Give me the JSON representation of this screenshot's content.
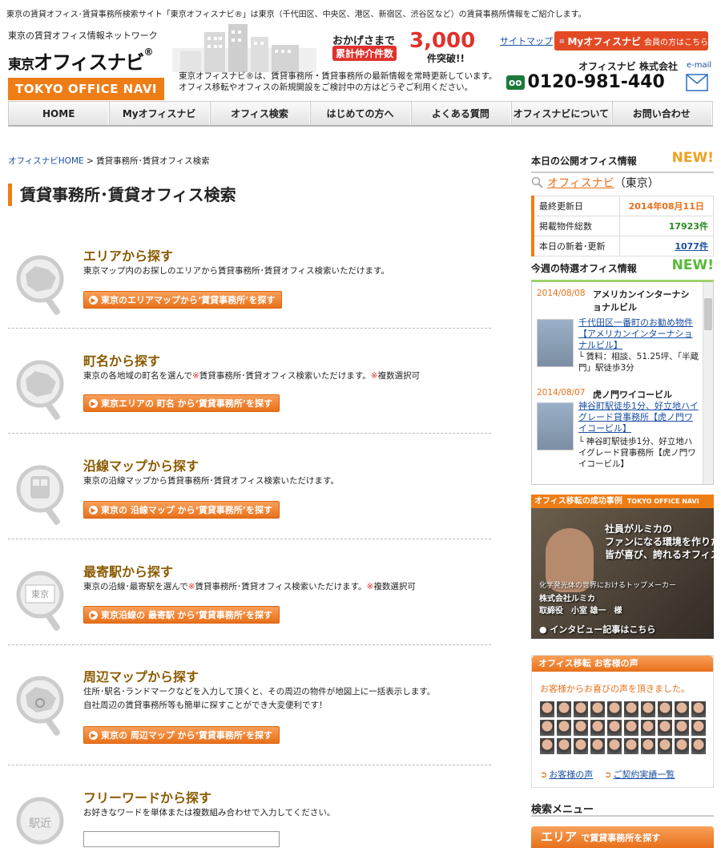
{
  "header": {
    "tagline": "東京の賃貸オフィス･賃貸事務所検索サイト「東京オフィスナビ®」は東京（千代田区、中央区、港区、新宿区、渋谷区など）の賃貸事務所情報をご紹介します。",
    "logo_sub": "東京の賃貸オフィス情報ネットワーク",
    "logo_small": "東京",
    "logo_main": "オフィスナビ",
    "logo_reg": "®",
    "logo_en": "TOKYO OFFICE NAVI",
    "desc_line1": "東京オフィスナビ®は、賃貸事務所・賃貸事務所の最新情報を常時更新しています。",
    "desc_line2": "オフィス移転やオフィスの新規開設をご検討中の方はどうぞご利用ください。",
    "okage_line1": "おかげさまで",
    "okage_line2": "累計仲介件数",
    "okage_num": "3,000",
    "okage_line3": "件突破!!",
    "sitemap": "サイトマップ",
    "my_btn": "Myオフィスナビ",
    "my_btn_small": "会員の方はこちら",
    "company": "オフィスナビ 株式会社",
    "email_label": "e-mail",
    "phone_prefix": "0120",
    "phone": "0120-981-440",
    "phone_badge": "フリーダイヤル"
  },
  "nav": [
    "HOME",
    "Myオフィスナビ",
    "オフィス検索",
    "はじめての方へ",
    "よくある質問",
    "オフィスナビについて",
    "お問い合わせ"
  ],
  "breadcrumb": {
    "home": "オフィスナビHOME",
    "sep": " > ",
    "current": "賃貸事務所･賃貸オフィス検索"
  },
  "page_title": "賃貸事務所･賃貸オフィス検索",
  "sections": [
    {
      "title": "エリアから探す",
      "desc": "東京マップ内のお探しのエリアから賃貸事務所･賃貸オフィス検索いただけます。",
      "button": "東京のエリアマップから‘賃貸事務所’を探す"
    },
    {
      "title": "町名から探す",
      "desc_a": "東京の各地域の町名を選んで",
      "desc_ast1": "※",
      "desc_b": "賃貸事務所･賃貸オフィス検索いただけます。",
      "desc_ast2": "※",
      "desc_c": "複数選択可",
      "button": "東京エリアの 町名 から‘賃貸事務所’を探す"
    },
    {
      "title": "沿線マップから探す",
      "desc": "東京の沿線マップから賃貸事務所･賃貸オフィス検索いただけます。",
      "button": "東京の 沿線マップ から‘賃貸事務所’を探す"
    },
    {
      "title": "最寄駅から探す",
      "desc_a": "東京の沿線･最寄駅を選んで",
      "desc_ast1": "※",
      "desc_b": "賃貸事務所･賃貸オフィス検索いただけます。",
      "desc_ast2": "※",
      "desc_c": "複数選択可",
      "button": "東京沿線の 最寄駅 から‘賃貸事務所’を探す",
      "icon_text": "東京"
    },
    {
      "title": "周辺マップから探す",
      "desc_line1": "住所･駅名･ランドマークなどを入力して頂くと、その周辺の物件が地図上に一括表示します。",
      "desc_line2": "自社周辺の賃貸事務所等も簡単に探すことができ大変便利です！",
      "button": "東京の 周辺マップ から‘賃貸事務所’を探す"
    },
    {
      "title": "フリーワードから探す",
      "desc": "お好きなワードを単体または複数組み合わせで入力してください。",
      "icon_text": "駅近"
    }
  ],
  "sidebar": {
    "today_title": "本日の公開オフィス情報",
    "new_badge": "NEW!",
    "search_link": "オフィスナビ",
    "search_suffix": "（東京）",
    "rows": [
      {
        "label": "最終更新日",
        "value": "2014年08月11日"
      },
      {
        "label": "掲載物件総数",
        "value": "17923件"
      },
      {
        "label": "本日の新着･更新",
        "value": "1077件"
      }
    ],
    "featured_title": "今週の特選オフィス情報",
    "featured": [
      {
        "date": "2014/08/08",
        "name": "アメリカンインターナショナルビル",
        "link": "千代田区一番町のお勧め物件【アメリカンインターナショナルビル】",
        "desc": "└ 賃料：相談、51.25坪、「半蔵門」駅徒歩3分"
      },
      {
        "date": "2014/08/07",
        "name": "虎ノ門ワイコービル",
        "link": "神谷町駅徒歩1分、好立地ハイグレード貸事務所【虎ノ門ワイコービル】",
        "desc": "└ 神谷町駅徒歩1分、好立地ハイグレード貸事務所【虎ノ門ワイコービル】"
      }
    ],
    "success_bar": "オフィス移転の成功事例",
    "success_bar_en": "TOKYO OFFICE NAVI",
    "success_quote1": "社員がルミカの",
    "success_quote2": "ファンになる環境を作りたい。",
    "success_quote3": "皆が喜び、誇れるオフィスに。",
    "success_company1": "化学発光体の世界におけるトップメーカー",
    "success_company2": "株式会社ルミカ",
    "success_person": "取締役　小室 雄一　様",
    "success_link": "インタビュー記事はこちら",
    "voices_bar": "オフィス移転 お客様の声",
    "voices_msg": "お客様からお喜びの声を頂きました。",
    "voices_link1": "お客様の声",
    "voices_link2": "ご契約実績一覧",
    "search_menu": "検索メニュー",
    "area_bar": "エリア",
    "area_bar_small": "で賃貸事務所を探す"
  }
}
